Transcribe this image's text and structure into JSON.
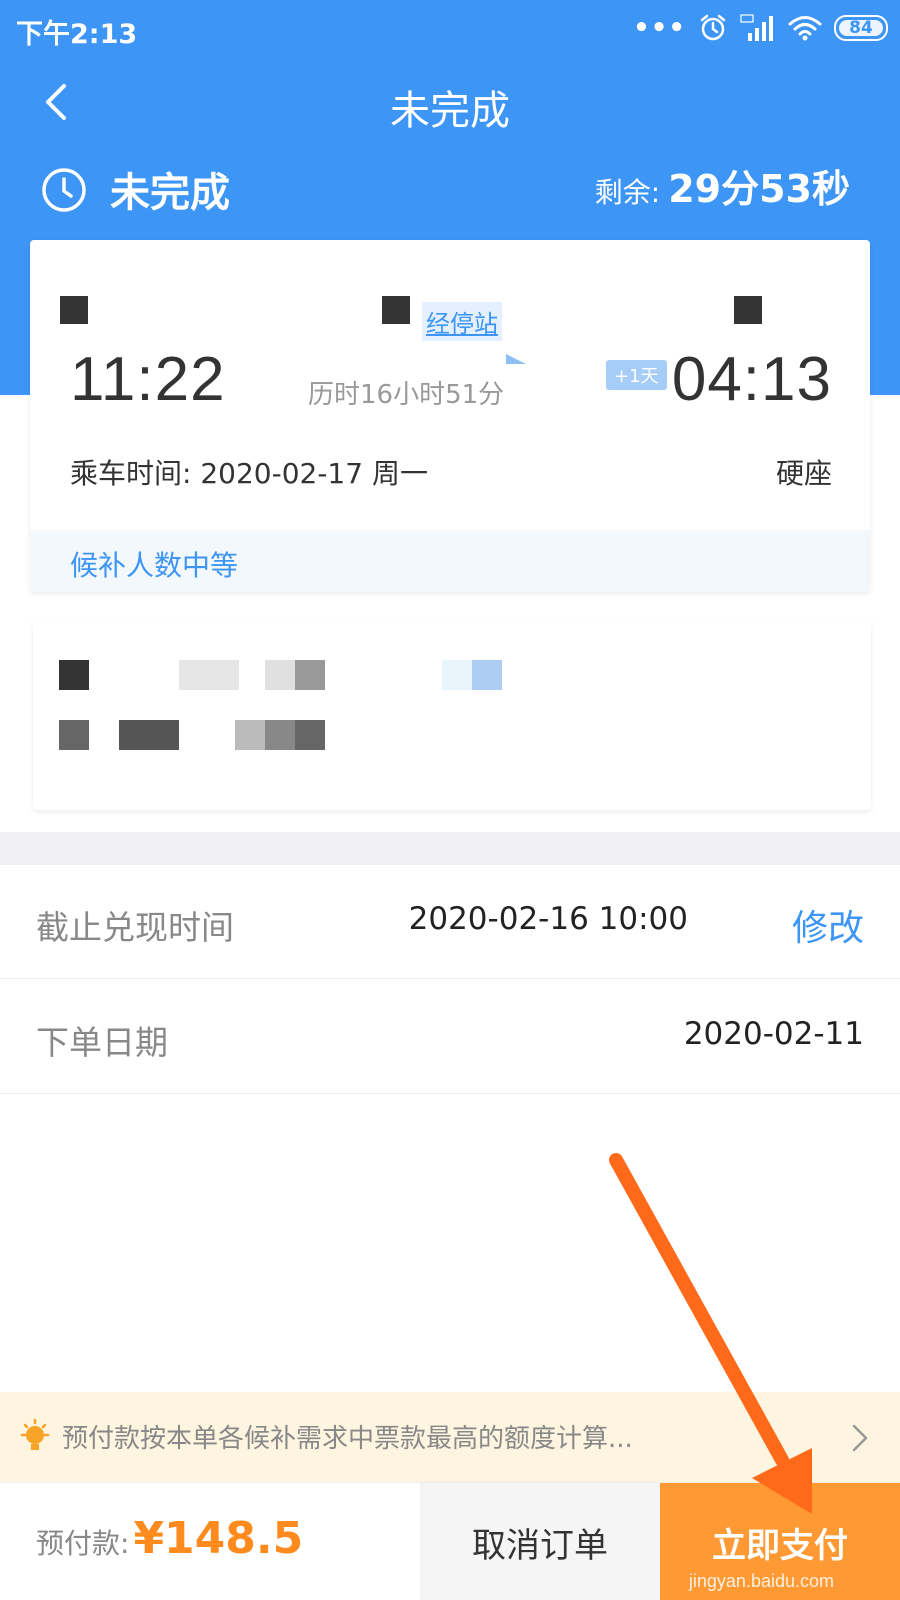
{
  "status_bar": {
    "time": "下午2:13",
    "dots": "•••",
    "battery": "84"
  },
  "nav": {
    "title": "未完成",
    "back_icon": "chevron-left-icon"
  },
  "order_status": {
    "label": "未完成",
    "remaining_label": "剩余:",
    "remaining_value": "29分53秒"
  },
  "train": {
    "departure_time": "11:22",
    "arrival_time": "04:13",
    "via_stations_link": "经停站",
    "duration": "历时16小时51分",
    "next_day_badge": "+1天",
    "ride_date": "乘车时间: 2020-02-17 周一",
    "seat_type": "硬座",
    "queue_level": "候补人数中等"
  },
  "details": {
    "deadline_label": "截止兑现时间",
    "deadline_value": "2020-02-16 10:00",
    "modify_label": "修改",
    "order_date_label": "下单日期",
    "order_date_value": "2020-02-11"
  },
  "notice": {
    "text": "预付款按本单各候补需求中票款最高的额度计算...",
    "icon": "lightbulb-icon"
  },
  "bottom_bar": {
    "prepay_label": "预付款:",
    "prepay_amount": "¥148.5",
    "cancel_label": "取消订单",
    "pay_label": "立即支付",
    "watermark": "jingyan.baidu.com"
  },
  "colors": {
    "primary": "#3d95f5",
    "accent_orange": "#ff9933",
    "price_orange": "#ff8a1e",
    "notice_bg": "#fef5e0"
  }
}
